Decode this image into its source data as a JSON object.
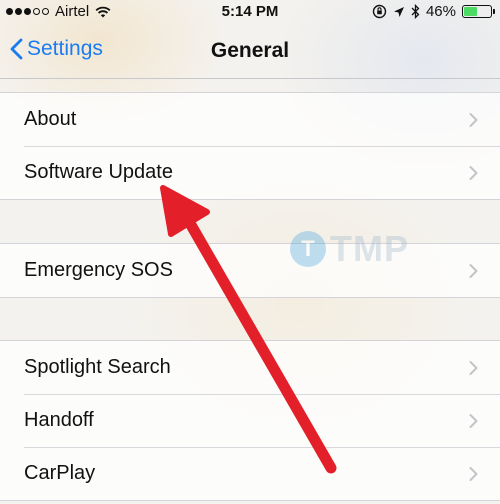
{
  "status_bar": {
    "carrier": "Airtel",
    "time": "5:14 PM",
    "battery_percent": "46%",
    "battery_level": 0.46,
    "icons": [
      "signal-dots-icon",
      "wifi-icon",
      "orientation-lock-icon",
      "location-icon",
      "bluetooth-icon",
      "battery-icon"
    ]
  },
  "nav": {
    "back_label": "Settings",
    "title": "General"
  },
  "groups": [
    {
      "items": [
        {
          "label": "About"
        },
        {
          "label": "Software Update"
        }
      ]
    },
    {
      "items": [
        {
          "label": "Emergency SOS"
        }
      ]
    },
    {
      "items": [
        {
          "label": "Spotlight Search"
        },
        {
          "label": "Handoff"
        },
        {
          "label": "CarPlay"
        }
      ]
    }
  ],
  "watermark": {
    "mark": "T",
    "text": "TMP"
  },
  "colors": {
    "accent": "#1b7cf2",
    "arrow": "#e3202a",
    "battery": "#4cd964"
  }
}
